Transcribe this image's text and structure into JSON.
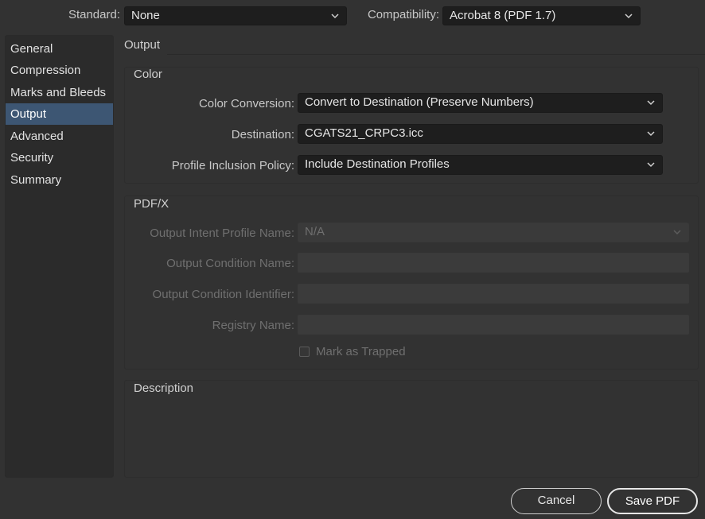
{
  "top": {
    "standard_label": "Standard:",
    "standard_value": "None",
    "compatibility_label": "Compatibility:",
    "compatibility_value": "Acrobat 8 (PDF 1.7)"
  },
  "sidebar": {
    "items": [
      {
        "label": "General"
      },
      {
        "label": "Compression"
      },
      {
        "label": "Marks and Bleeds"
      },
      {
        "label": "Output"
      },
      {
        "label": "Advanced"
      },
      {
        "label": "Security"
      },
      {
        "label": "Summary"
      }
    ],
    "active": "Output"
  },
  "panel": {
    "title": "Output",
    "color_group": {
      "title": "Color",
      "color_conversion_label": "Color Conversion:",
      "color_conversion_value": "Convert to Destination (Preserve Numbers)",
      "destination_label": "Destination:",
      "destination_value": "CGATS21_CRPC3.icc",
      "profile_policy_label": "Profile Inclusion Policy:",
      "profile_policy_value": "Include Destination Profiles"
    },
    "pdfx_group": {
      "title": "PDF/X",
      "output_intent_label": "Output Intent Profile Name:",
      "output_intent_value": "N/A",
      "output_condition_name_label": "Output Condition Name:",
      "output_condition_name_value": "",
      "output_condition_id_label": "Output Condition Identifier:",
      "output_condition_id_value": "",
      "registry_name_label": "Registry Name:",
      "registry_name_value": "",
      "mark_trapped_label": "Mark as Trapped",
      "mark_trapped_checked": false
    },
    "description_group": {
      "title": "Description",
      "text": ""
    }
  },
  "buttons": {
    "cancel": "Cancel",
    "save": "Save PDF"
  },
  "colors": {
    "background": "#323232",
    "sidebar_active": "#3d5673",
    "select_bg": "#1e1e1e"
  }
}
